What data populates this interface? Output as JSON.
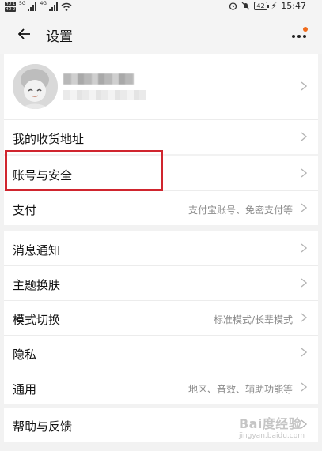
{
  "status_bar": {
    "sim1": "HD 1",
    "sim2": "HD 2",
    "net1": "5G",
    "net2": "4G",
    "battery": "42",
    "time": "15:47"
  },
  "header": {
    "title": "设置"
  },
  "groups": [
    {
      "rows": [
        {
          "type": "profile"
        },
        {
          "label": "我的收货地址"
        }
      ]
    },
    {
      "rows": [
        {
          "label": "账号与安全"
        },
        {
          "label": "支付",
          "hint": "支付宝账号、免密支付等"
        }
      ]
    },
    {
      "rows": [
        {
          "label": "消息通知"
        },
        {
          "label": "主题换肤"
        },
        {
          "label": "模式切换",
          "hint": "标准模式/长辈模式"
        },
        {
          "label": "隐私"
        },
        {
          "label": "通用",
          "hint": "地区、音效、辅助功能等"
        }
      ]
    },
    {
      "rows": [
        {
          "label": "帮助与反馈"
        }
      ]
    }
  ],
  "watermark": {
    "text": "Bai度经验",
    "sub": "jingyan.baidu.com"
  },
  "colors": {
    "highlight": "#d0252e",
    "badge": "#f06a1a",
    "background": "#f2f2f2"
  }
}
